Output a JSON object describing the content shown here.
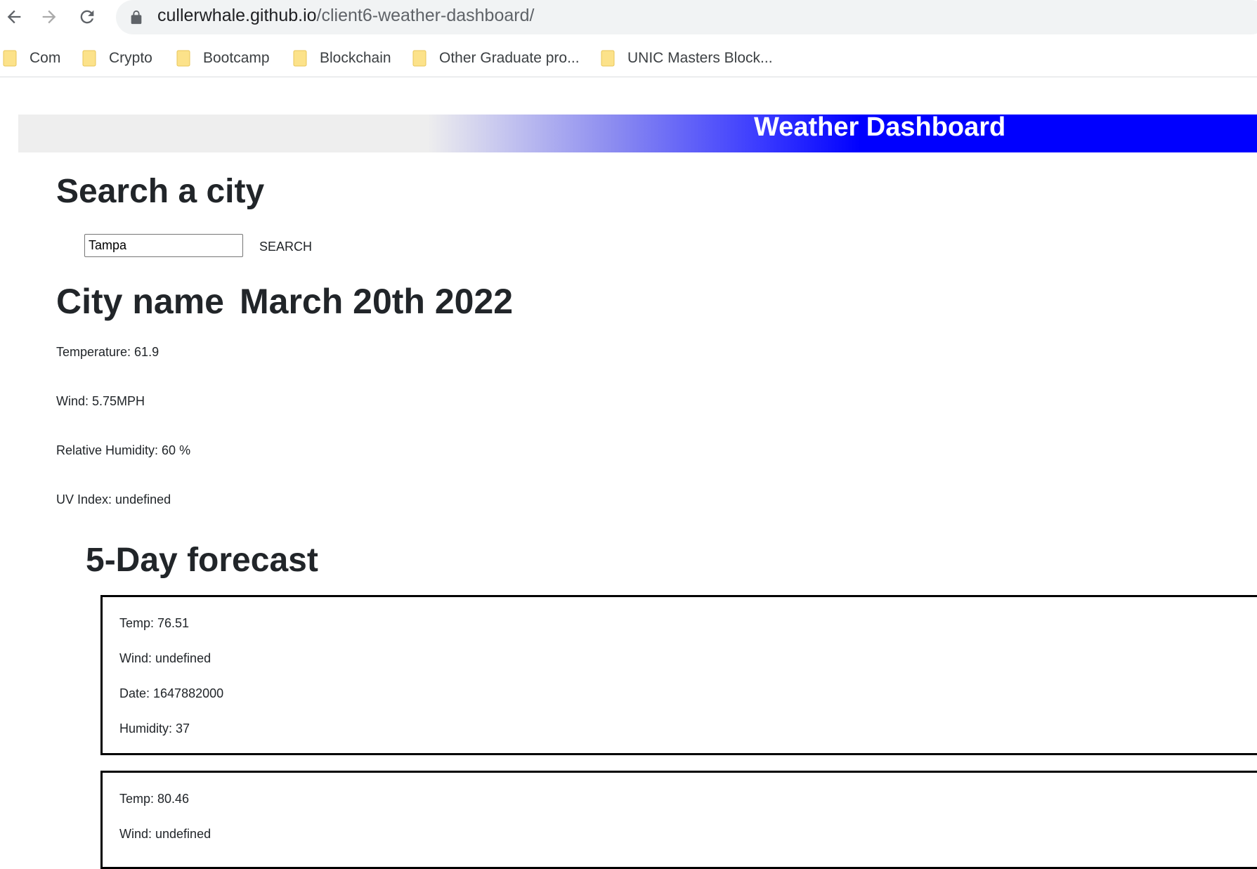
{
  "browser": {
    "url_domain": "cullerwhale.github.io",
    "url_path": "/client6-weather-dashboard/",
    "bookmarks": [
      {
        "label": "Com"
      },
      {
        "label": "Crypto"
      },
      {
        "label": "Bootcamp"
      },
      {
        "label": "Blockchain"
      },
      {
        "label": "Other Graduate pro..."
      },
      {
        "label": "UNIC Masters Block..."
      }
    ],
    "folder_color": "#fce28a"
  },
  "header": {
    "title": "Weather Dashboard",
    "accent_color": "#0000ff"
  },
  "search": {
    "heading": "Search a city",
    "input_value": "Tampa",
    "button_label": "SEARCH"
  },
  "current": {
    "city": "City name",
    "date": "March 20th 2022",
    "temperature": "Temperature: 61.9",
    "wind": "Wind: 5.75MPH",
    "humidity": "Relative Humidity: 60 %",
    "uv_index": "UV Index: undefined"
  },
  "forecast": {
    "heading": "5-Day forecast",
    "cards": [
      {
        "temp": "Temp: 76.51",
        "wind": "Wind: undefined",
        "date": "Date: 1647882000",
        "humidity": "Humidity: 37"
      },
      {
        "temp": "Temp: 80.46",
        "wind": "Wind: undefined"
      }
    ]
  }
}
